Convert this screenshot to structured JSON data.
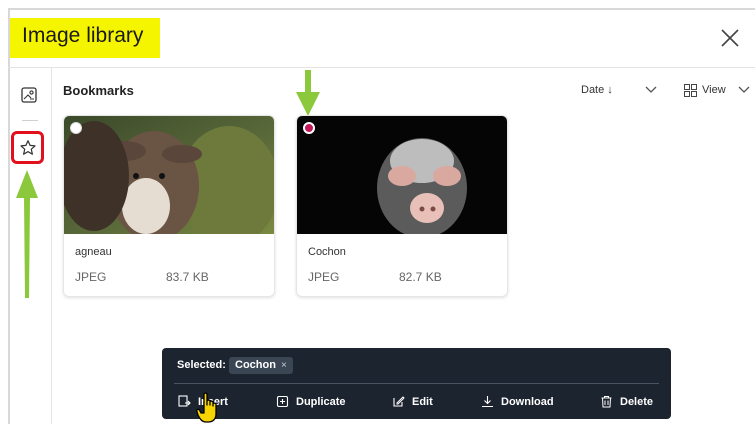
{
  "dialog": {
    "title": "Image library"
  },
  "sidebar": {
    "items": [
      {
        "icon": "image-library-icon"
      },
      {
        "icon": "star-icon",
        "selected": true
      }
    ]
  },
  "main": {
    "section_title": "Bookmarks",
    "sort": {
      "label": "Date ↓"
    },
    "view": {
      "label": "View",
      "icon": "grid-icon"
    }
  },
  "cards": [
    {
      "name": "agneau",
      "type": "JPEG",
      "size": "83.7 KB",
      "selected": false
    },
    {
      "name": "Cochon",
      "type": "JPEG",
      "size": "82.7 KB",
      "selected": true
    }
  ],
  "selection_bar": {
    "label": "Selected:",
    "chip": "Cochon",
    "chip_close": "×",
    "actions": [
      {
        "label": "Insert",
        "icon": "insert-icon"
      },
      {
        "label": "Duplicate",
        "icon": "duplicate-icon"
      },
      {
        "label": "Edit",
        "icon": "edit-icon"
      },
      {
        "label": "Download",
        "icon": "download-icon"
      },
      {
        "label": "Delete",
        "icon": "trash-icon"
      }
    ]
  },
  "colors": {
    "title_highlight": "#f5f500",
    "arrow": "#8cc83c",
    "select_accent": "#c2185b",
    "toolbar_bg": "#1c2430",
    "highlight_border": "#e0101c"
  }
}
